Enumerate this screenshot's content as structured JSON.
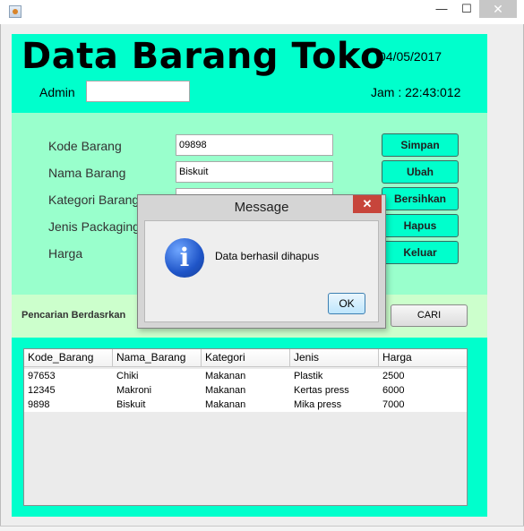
{
  "window": {
    "minimize_glyph": "—",
    "maximize_glyph": "☐",
    "close_glyph": "✕"
  },
  "header": {
    "title": "Data Barang Toko",
    "date": "04/05/2017",
    "time": "Jam : 22:43:012",
    "admin_label": "Admin",
    "admin_value": ""
  },
  "form": {
    "kode_label": "Kode Barang",
    "kode_value": "09898",
    "nama_label": "Nama Barang",
    "nama_value": "Biskuit",
    "kategori_label": "Kategori Barang",
    "jenis_label": "Jenis Packaging",
    "harga_label": "Harga"
  },
  "buttons": {
    "simpan": "Simpan",
    "ubah": "Ubah",
    "bersihkan": "Bersihkan",
    "hapus": "Hapus",
    "keluar": "Keluar",
    "cari": "CARI"
  },
  "search": {
    "label": "Pencarian Berdasrkan"
  },
  "table": {
    "columns": [
      "Kode_Barang",
      "Nama_Barang",
      "Kategori",
      "Jenis",
      "Harga"
    ],
    "rows": [
      [
        "97653",
        "Chiki",
        "Makanan",
        "Plastik",
        "2500"
      ],
      [
        "12345",
        "Makroni",
        "Makanan",
        "Kertas press",
        "6000"
      ],
      [
        "9898",
        "Biskuit",
        "Makanan",
        "Mika press",
        "7000"
      ]
    ]
  },
  "dialog": {
    "title": "Message",
    "message": "Data berhasil dihapus",
    "ok_label": "OK",
    "close_glyph": "✕",
    "icon_glyph": "i"
  },
  "colors": {
    "top_panel": "#00ffcc",
    "form_panel": "#99ffcc",
    "search_panel": "#ccffcc",
    "info_icon": "#1f55c8"
  }
}
